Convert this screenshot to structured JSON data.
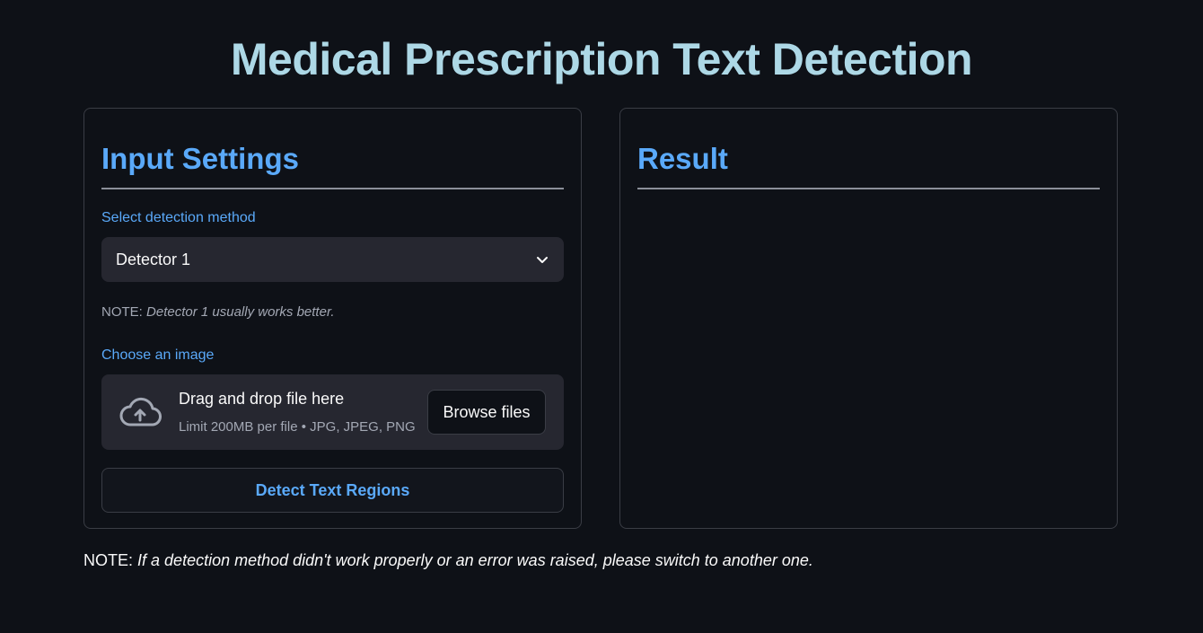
{
  "app": {
    "title": "Medical Prescription Text Detection"
  },
  "input_panel": {
    "title": "Input Settings",
    "method_label": "Select detection method",
    "method_selected": "Detector 1",
    "note_prefix": "NOTE:",
    "note_text": "Detector 1 usually works better.",
    "image_label": "Choose an image",
    "uploader": {
      "title": "Drag and drop file here",
      "limit": "Limit 200MB per file • JPG, JPEG, PNG",
      "browse_label": "Browse files",
      "icon": "cloud-upload-icon"
    },
    "detect_button": "Detect Text Regions"
  },
  "result_panel": {
    "title": "Result"
  },
  "footer": {
    "note_prefix": "NOTE:",
    "note_text": "If a detection method didn't work properly or an error was raised, please switch to another one."
  },
  "colors": {
    "background": "#0e1117",
    "title": "#add8e6",
    "accent": "#5aa9f9",
    "widget_bg": "#262730",
    "border": "#3a3d45"
  }
}
